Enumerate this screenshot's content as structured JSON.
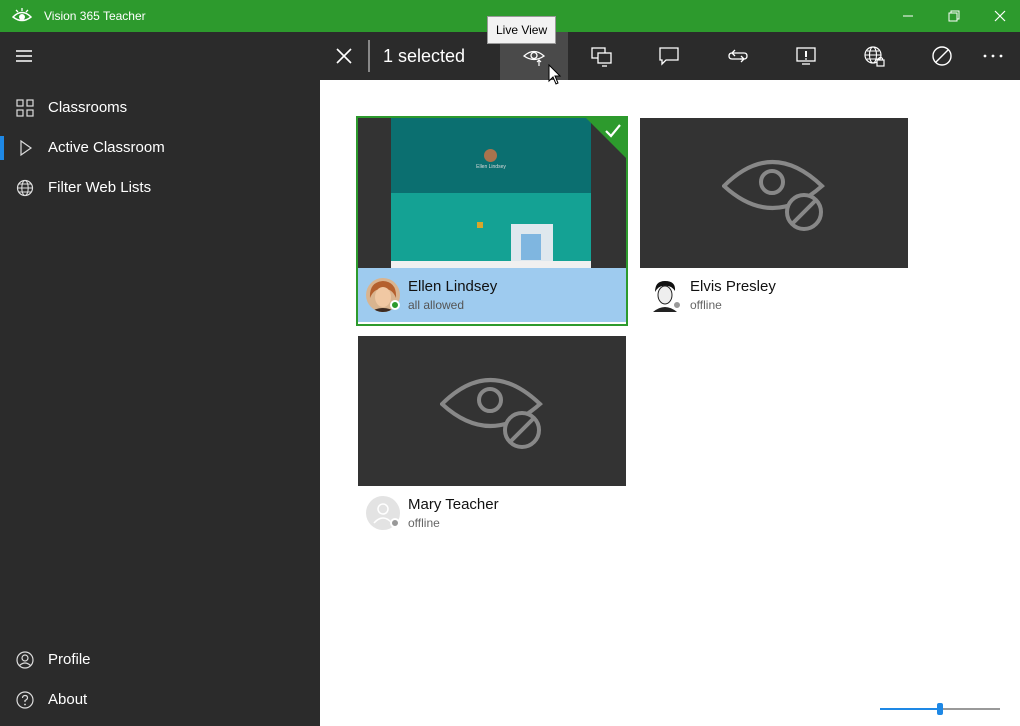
{
  "window": {
    "title": "Vision 365 Teacher",
    "accent_color": "#2d9a2d"
  },
  "sidebar": {
    "menu_icon": "hamburger-icon",
    "items": [
      {
        "label": "Classrooms",
        "icon": "grid-icon"
      },
      {
        "label": "Active Classroom",
        "icon": "play-icon",
        "active": true
      },
      {
        "label": "Filter Web Lists",
        "icon": "globe-icon"
      }
    ],
    "bottom_items": [
      {
        "label": "Profile",
        "icon": "person-icon"
      },
      {
        "label": "About",
        "icon": "help-icon"
      }
    ]
  },
  "command_bar": {
    "selected_text": "1 selected",
    "tooltip": "Live View",
    "buttons": [
      {
        "name": "live-view",
        "icon": "eye-icon"
      },
      {
        "name": "share-screen",
        "icon": "monitors-icon"
      },
      {
        "name": "message",
        "icon": "chat-icon"
      },
      {
        "name": "share",
        "icon": "loop-icon"
      },
      {
        "name": "alert",
        "icon": "alert-icon"
      },
      {
        "name": "web-limits",
        "icon": "globe-lock-icon"
      },
      {
        "name": "block",
        "icon": "block-icon"
      },
      {
        "name": "more",
        "icon": "more-icon"
      }
    ]
  },
  "students": [
    {
      "name": "Ellen Lindsey",
      "status": "all allowed",
      "online": true,
      "selected": true
    },
    {
      "name": "Elvis Presley",
      "status": "offline",
      "online": false,
      "selected": false
    },
    {
      "name": "Mary Teacher",
      "status": "offline",
      "online": false,
      "selected": false
    }
  ],
  "mini_screen": {
    "student_name": "Ellen Lindsey"
  },
  "zoom": {
    "level_fraction": 0.5
  }
}
